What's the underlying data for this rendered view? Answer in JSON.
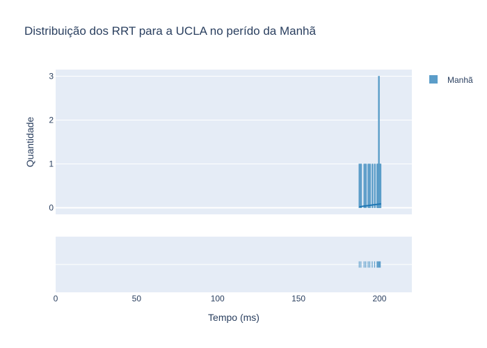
{
  "chart_data": {
    "type": "histogram",
    "title": "Distribuição dos RRT para a UCLA no perído da Manhã",
    "xlabel": "Tempo (ms)",
    "ylabel": "Quantidade",
    "xlim": [
      0,
      220
    ],
    "ylim": [
      -0.15,
      3.15
    ],
    "x_ticks": [
      0,
      50,
      100,
      150,
      200
    ],
    "y_ticks": [
      0,
      1,
      2,
      3
    ],
    "bin_width": 0.5,
    "series": [
      {
        "name": "Manhã",
        "color": "#5b9dc9",
        "bins": [
          {
            "x": 187.5,
            "count": 1
          },
          {
            "x": 188.5,
            "count": 1
          },
          {
            "x": 190.5,
            "count": 1
          },
          {
            "x": 191.5,
            "count": 1
          },
          {
            "x": 193.0,
            "count": 1
          },
          {
            "x": 194.0,
            "count": 1
          },
          {
            "x": 195.5,
            "count": 1
          },
          {
            "x": 197.0,
            "count": 1
          },
          {
            "x": 198.5,
            "count": 1
          },
          {
            "x": 199.0,
            "count": 1
          },
          {
            "x": 199.5,
            "count": 3
          },
          {
            "x": 200.0,
            "count": 1
          },
          {
            "x": 200.5,
            "count": 1
          }
        ],
        "rug": [
          187.5,
          188.5,
          190.5,
          191.5,
          193.0,
          194.0,
          195.5,
          197.0,
          198.5,
          199.0,
          199.5,
          199.6,
          199.7,
          200.0,
          200.5
        ],
        "density": [
          [
            187.5,
            0.02
          ],
          [
            190,
            0.035
          ],
          [
            193,
            0.05
          ],
          [
            196,
            0.065
          ],
          [
            199,
            0.08
          ],
          [
            201,
            0.09
          ]
        ]
      }
    ],
    "legend_position": "top-right"
  }
}
